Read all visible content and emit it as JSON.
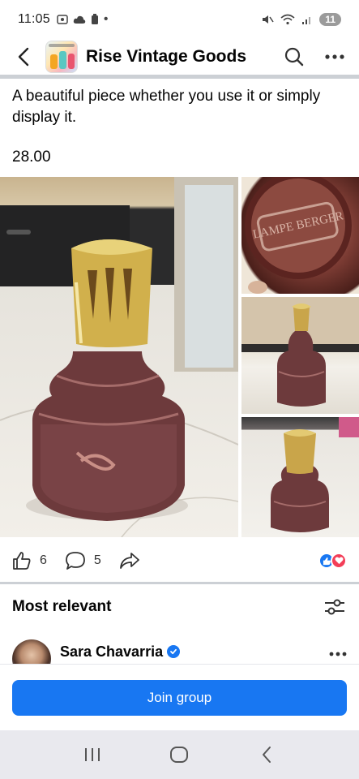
{
  "status_bar": {
    "time": "11:05",
    "notification_count": "11"
  },
  "header": {
    "group_name": "Rise Vintage Goods"
  },
  "post": {
    "text": "A beautiful piece whether you use it or simply display it.",
    "price": "28.00",
    "photo_embossed_text": "LAMPE BERGER"
  },
  "stats": {
    "likes": "6",
    "comments": "5"
  },
  "comments": {
    "sort_label": "Most relevant",
    "first_commenter": "Sara Chavarria"
  },
  "join": {
    "label": "Join group"
  },
  "colors": {
    "accent": "#1877f2",
    "love": "#f33e58"
  }
}
